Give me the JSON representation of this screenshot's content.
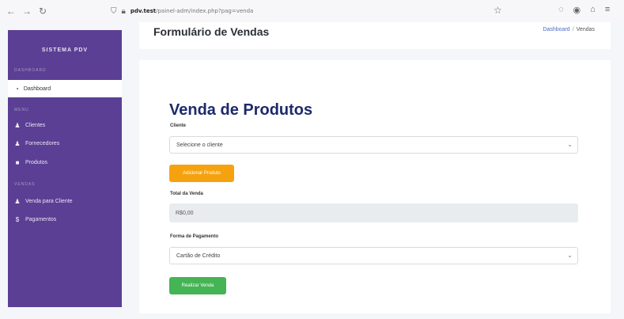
{
  "browser": {
    "back_icon": "←",
    "forward_icon": "→",
    "reload_icon": "↻",
    "url_host": "pdv.test",
    "url_path": "/painel-adm/index.php?pag=venda",
    "star_icon": "☆"
  },
  "sidebar": {
    "brand": "SISTEMA PDV",
    "sections": [
      "DASHBOARD",
      "MENU",
      "VENDAS"
    ],
    "active_item": {
      "label": "Dashboard",
      "icon": "gauge-icon"
    },
    "menu_items": [
      {
        "label": "Clientes",
        "icon": "users-icon"
      },
      {
        "label": "Fornecedores",
        "icon": "users-icon"
      },
      {
        "label": "Produtos",
        "icon": "box-icon"
      }
    ],
    "sales_items": [
      {
        "label": "Venda para Cliente",
        "icon": "users-icon"
      },
      {
        "label": "Pagamentos",
        "icon": "dollar-icon"
      }
    ]
  },
  "header": {
    "title": "Formulário de Vendas",
    "breadcrumb_home": "Dashboard",
    "breadcrumb_sep": "/",
    "breadcrumb_current": "Vendas"
  },
  "form": {
    "title": "Venda de Produtos",
    "cliente_label": "Cliente",
    "cliente_value": "Selecione o cliente",
    "add_product_button": "Adicionar Produto",
    "total_label": "Total da Venda",
    "total_value": "R$0,00",
    "payment_label": "Forma de Pagamento",
    "payment_value": "Cartão de Crédito",
    "submit_button": "Realizar Venda"
  },
  "colors": {
    "sidebar_bg": "#5b3f94",
    "title_color": "#1c2a6b",
    "warning": "#f6a20f",
    "success": "#45b455"
  }
}
